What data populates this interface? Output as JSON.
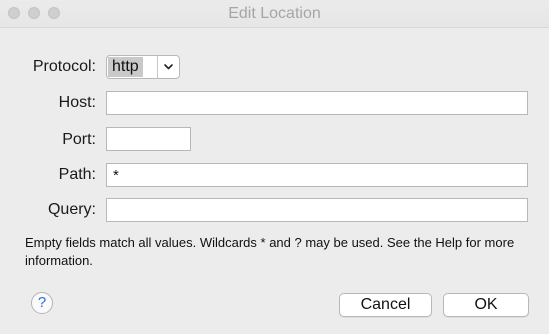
{
  "window": {
    "title": "Edit Location"
  },
  "form": {
    "protocol": {
      "label": "Protocol:",
      "selected": "http"
    },
    "host": {
      "label": "Host:",
      "value": ""
    },
    "port": {
      "label": "Port:",
      "value": ""
    },
    "path": {
      "label": "Path:",
      "value": "*"
    },
    "query": {
      "label": "Query:",
      "value": ""
    }
  },
  "help_text": "Empty fields match all values. Wildcards * and ? may be used. See the Help for more information.",
  "buttons": {
    "help": "?",
    "cancel": "Cancel",
    "ok": "OK"
  },
  "icons": {
    "dropdown": "chevron-down-icon",
    "help": "question-icon"
  }
}
